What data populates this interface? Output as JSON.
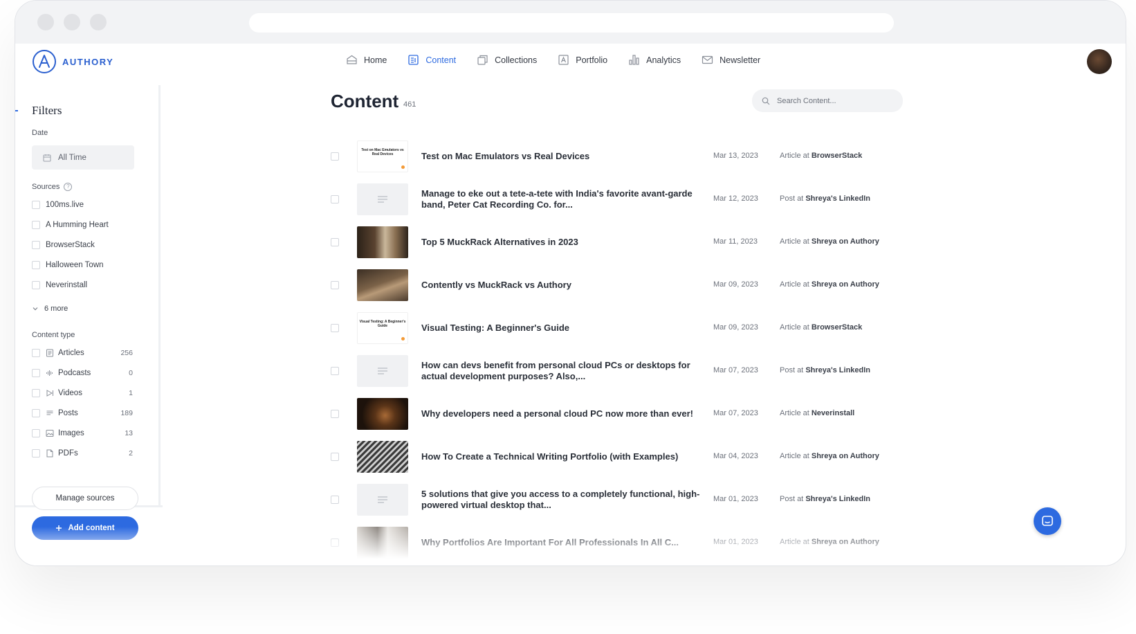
{
  "app": {
    "name": "AUTHORY"
  },
  "nav": {
    "items": [
      {
        "label": "Home",
        "icon": "home-icon",
        "active": false
      },
      {
        "label": "Content",
        "icon": "content-icon",
        "active": true
      },
      {
        "label": "Collections",
        "icon": "collections-icon",
        "active": false
      },
      {
        "label": "Portfolio",
        "icon": "portfolio-icon",
        "active": false
      },
      {
        "label": "Analytics",
        "icon": "analytics-icon",
        "active": false
      },
      {
        "label": "Newsletter",
        "icon": "newsletter-icon",
        "active": false
      }
    ]
  },
  "sidebar": {
    "title": "Filters",
    "date_label": "Date",
    "date_value": "All Time",
    "sources_label": "Sources",
    "sources": [
      "100ms.live",
      "A Humming Heart",
      "BrowserStack",
      "Halloween Town",
      "Neverinstall"
    ],
    "more_label": "6 more",
    "content_type_label": "Content type",
    "content_types": [
      {
        "label": "Articles",
        "count": "256",
        "icon": "article-icon"
      },
      {
        "label": "Podcasts",
        "count": "0",
        "icon": "podcast-icon"
      },
      {
        "label": "Videos",
        "count": "1",
        "icon": "video-icon"
      },
      {
        "label": "Posts",
        "count": "189",
        "icon": "post-icon"
      },
      {
        "label": "Images",
        "count": "13",
        "icon": "image-icon"
      },
      {
        "label": "PDFs",
        "count": "2",
        "icon": "pdf-icon"
      }
    ],
    "manage_label": "Manage sources",
    "add_label": "Add content"
  },
  "main": {
    "title": "Content",
    "count": "461",
    "search_placeholder": "Search Content...",
    "rows": [
      {
        "title": "Test on Mac Emulators vs Real Devices",
        "date": "Mar 13, 2023",
        "kind": "Article at",
        "source": "BrowserStack",
        "thumb": "card",
        "card_text": "Test on Mac Emulators vs Real Devices"
      },
      {
        "title": "Manage to eke out a tete-a-tete with India's favorite avant-garde band, Peter Cat Recording Co. for...",
        "date": "Mar 12, 2023",
        "kind": "Post at",
        "source": "Shreya's LinkedIn",
        "thumb": "post"
      },
      {
        "title": "Top 5 MuckRack Alternatives in 2023",
        "date": "Mar 11, 2023",
        "kind": "Article at",
        "source": "Shreya on Authory",
        "thumb": "photo1"
      },
      {
        "title": "Contently vs MuckRack vs Authory",
        "date": "Mar 09, 2023",
        "kind": "Article at",
        "source": "Shreya on Authory",
        "thumb": "photo2"
      },
      {
        "title": "Visual Testing: A Beginner's Guide",
        "date": "Mar 09, 2023",
        "kind": "Article at",
        "source": "BrowserStack",
        "thumb": "card",
        "card_text": "Visual Testing: A Beginner's Guide"
      },
      {
        "title": "How can devs benefit from personal cloud PCs or desktops for actual development purposes? Also,...",
        "date": "Mar 07, 2023",
        "kind": "Post at",
        "source": "Shreya's LinkedIn",
        "thumb": "post"
      },
      {
        "title": "Why developers need a personal cloud PC now more than ever!",
        "date": "Mar 07, 2023",
        "kind": "Article at",
        "source": "Neverinstall",
        "thumb": "photo3"
      },
      {
        "title": "How To Create a Technical Writing Portfolio (with Examples)",
        "date": "Mar 04, 2023",
        "kind": "Article at",
        "source": "Shreya on Authory",
        "thumb": "photo4"
      },
      {
        "title": "5 solutions that give you access to a completely functional, high-powered virtual desktop that...",
        "date": "Mar 01, 2023",
        "kind": "Post at",
        "source": "Shreya's LinkedIn",
        "thumb": "post"
      },
      {
        "title": "Why Portfolios Are Important For All Professionals In All C...",
        "date": "Mar 01, 2023",
        "kind": "Article at",
        "source": "Shreya on Authory",
        "thumb": "photo5"
      }
    ]
  }
}
